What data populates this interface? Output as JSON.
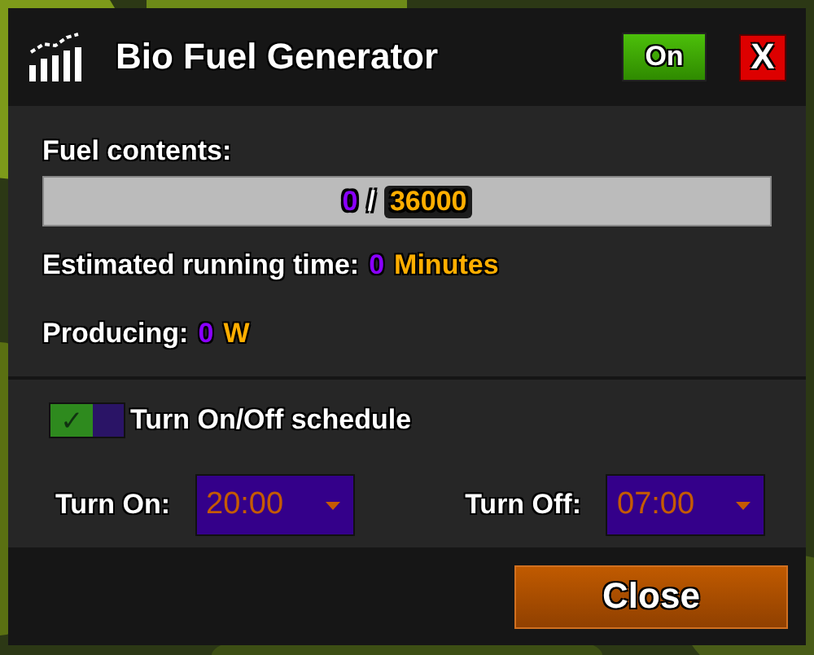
{
  "window": {
    "title": "Bio Fuel Generator"
  },
  "power_button": {
    "label": "On",
    "on": true
  },
  "close_x": "X",
  "fuel": {
    "label": "Fuel contents:",
    "level": 0,
    "current": "0",
    "separator": "/",
    "capacity": "36000"
  },
  "running_time": {
    "label": "Estimated running time:",
    "value": "0",
    "unit": "Minutes"
  },
  "producing": {
    "label": "Producing:",
    "value": "0",
    "unit": "W"
  },
  "schedule": {
    "label": "Turn On/Off schedule",
    "checked": true,
    "check_glyph": "✓"
  },
  "times": [
    {
      "label": "Turn On:",
      "value": "20:00"
    },
    {
      "label": "Turn Off:",
      "value": "07:00"
    }
  ],
  "close_button": "Close"
}
